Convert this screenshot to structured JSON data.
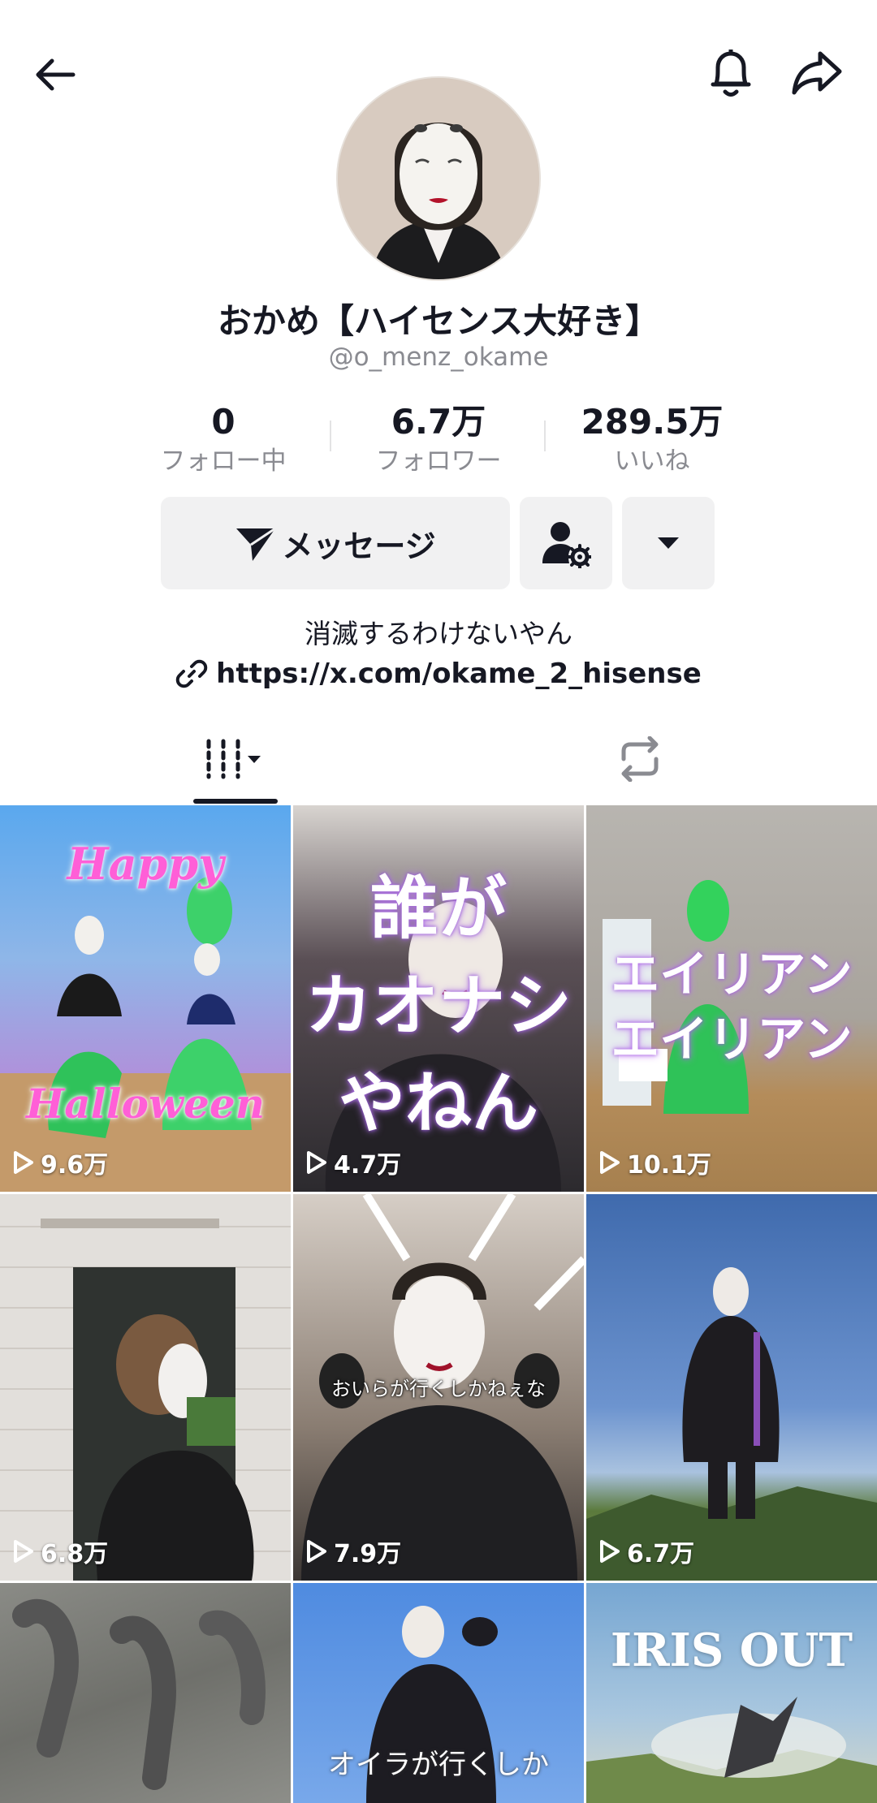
{
  "header": {
    "back_icon": "arrow-left-icon",
    "bell_icon": "bell-icon",
    "share_icon": "share-arrow-icon"
  },
  "profile": {
    "display_name": "おかめ【ハイセンス大好き】",
    "handle": "@o_menz_okame",
    "stats": [
      {
        "value": "0",
        "label": "フォロー中"
      },
      {
        "value": "6.7万",
        "label": "フォロワー"
      },
      {
        "value": "289.5万",
        "label": "いいね"
      }
    ],
    "message_button": "メッセージ",
    "bio": "消滅するわけないやん",
    "link": "https://x.com/okame_2_hisense"
  },
  "tabs": [
    {
      "icon": "videos-grid-icon",
      "active": true
    },
    {
      "icon": "repost-icon",
      "active": false
    }
  ],
  "videos": [
    {
      "views": "9.6万",
      "text_top": "Happy",
      "text_bottom": "Halloween",
      "bg": "#6fb3ea"
    },
    {
      "views": "4.7万",
      "text_lines": [
        "誰が",
        "カオナシ",
        "やねん"
      ],
      "bg": "#4a4448"
    },
    {
      "views": "10.1万",
      "text_lines": [
        "エイリアン",
        "エイリアン"
      ],
      "bg": "#9a958f"
    },
    {
      "views": "6.8万",
      "bg": "#d9d6d2"
    },
    {
      "views": "7.9万",
      "caption": "おいらが行くしかねぇな",
      "bg": "#6b625c"
    },
    {
      "views": "6.7万",
      "bg": "#4c6fa8"
    },
    {
      "views": "",
      "bg": "#7f807c"
    },
    {
      "views": "",
      "caption": "オイラが行くしか",
      "bg": "#5c8fd6"
    },
    {
      "views": "",
      "text_lines": [
        "IRIS OUT"
      ],
      "bg": "#8fb3cf"
    }
  ]
}
